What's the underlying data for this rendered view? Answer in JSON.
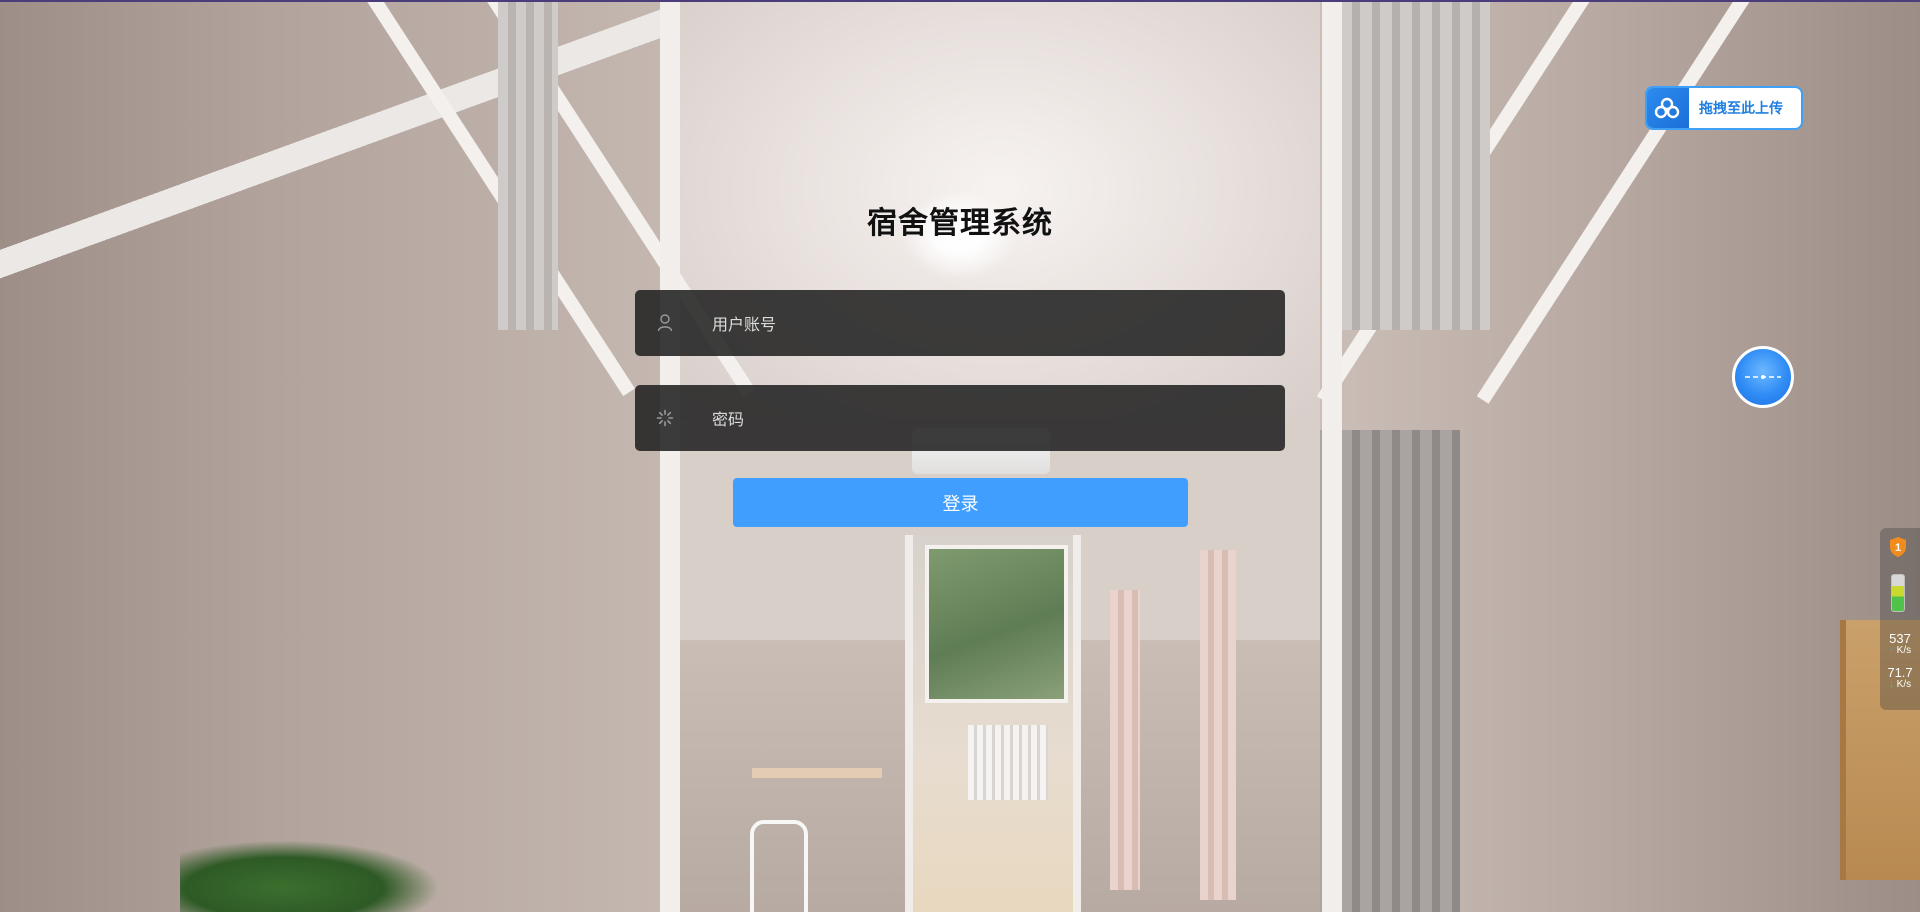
{
  "app": {
    "title": "宿舍管理系统"
  },
  "login": {
    "username_placeholder": "用户账号",
    "password_placeholder": "密码",
    "submit_label": "登录"
  },
  "overlays": {
    "upload_chip_label": "拖拽至此上传",
    "net_speed": {
      "upload_value": "537",
      "upload_unit": "K/s",
      "download_value": "71.7",
      "download_unit": "K/s"
    },
    "shield_badge": "1"
  },
  "colors": {
    "accent": "#409eff",
    "field_bg": "#222222",
    "chip_border": "#3fa0f5",
    "title": "#111111"
  },
  "icons": {
    "username": "user-icon",
    "password": "lock-icon",
    "upload_chip": "cloud-icon",
    "float_ball": "assistant-ball-icon",
    "shield": "shield-icon",
    "battery": "battery-icon"
  }
}
